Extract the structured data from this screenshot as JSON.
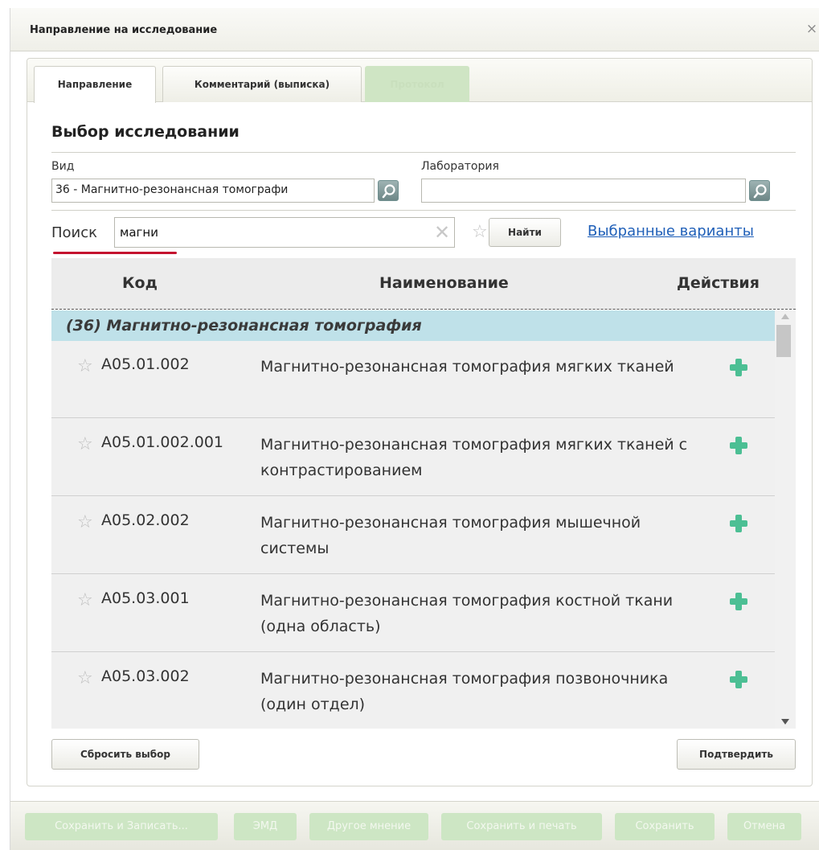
{
  "window": {
    "title": "Направление на исследование",
    "close_icon": "×"
  },
  "tabs": [
    {
      "label": "Направление",
      "active": true
    },
    {
      "label": "Комментарий (выписка)",
      "active": false
    },
    {
      "label": "Протокол",
      "active": false,
      "disabled": true
    }
  ],
  "section_title": "Выбор исследовании",
  "filters": {
    "vid_label": "Вид",
    "vid_value": "36 - Магнитно-резонансная томографи",
    "lab_label": "Лаборатория",
    "lab_value": ""
  },
  "search": {
    "label": "Поиск",
    "value": "магни",
    "find_button": "Найти",
    "selected_link": "Выбранные варианты"
  },
  "table": {
    "headers": {
      "code": "Код",
      "name": "Наименование",
      "actions": "Действия"
    },
    "group": "(36) Магнитно-резонансная томография",
    "rows": [
      {
        "code": "A05.01.002",
        "name": "Магнитно-резонансная томография мягких тканей"
      },
      {
        "code": "A05.01.002.001",
        "name": "Магнитно-резонансная томография мягких тканей с контрастированием"
      },
      {
        "code": "A05.02.002",
        "name": "Магнитно-резонансная томография мышечной системы"
      },
      {
        "code": "A05.03.001",
        "name": "Магнитно-резонансная томография костной ткани (одна область)"
      },
      {
        "code": "A05.03.002",
        "name": "Магнитно-резонансная томография позвоночника (один отдел)"
      }
    ]
  },
  "actions": {
    "reset": "Сбросить выбор",
    "confirm": "Подтвердить"
  },
  "footer": {
    "save_and_record": "Сохранить и Записать...",
    "emd": "ЭМД",
    "other_opinion": "Другое мнение",
    "save_and_print": "Сохранить и печать",
    "save": "Сохранить",
    "cancel": "Отмена"
  },
  "colors": {
    "group_row": "#bfe1e9",
    "add_icon": "#4cbf94",
    "link": "#1f5fb8",
    "search_underline": "#c4122f",
    "disabled_button": "#cde6c4"
  },
  "icons": {
    "lookup": "magnifier-icon",
    "favorite": "star-icon",
    "add": "plus-icon",
    "clear": "clear-icon"
  }
}
